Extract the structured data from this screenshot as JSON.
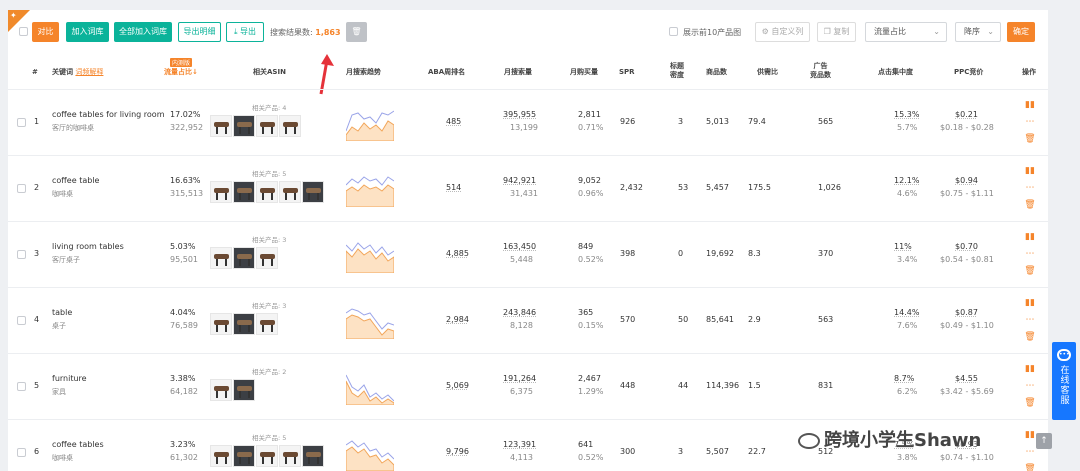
{
  "toolbar": {
    "compare": "对比",
    "add_lib": "加入词库",
    "add_all_lib": "全部加入词库",
    "export_detail": "导出明细",
    "export": "导出",
    "result_label": "搜索结果数:",
    "result_count": "1,863",
    "top10_label": "展示前10产品图",
    "custom_cols": "自定义列",
    "copy": "复制",
    "sort_field": "流量占比",
    "sort_order": "降序",
    "confirm": "确定"
  },
  "header": {
    "num": "#",
    "keyword": "关键词",
    "keyword_tag": "词频解释",
    "traffic": "流量占比↓",
    "traffic_tag": "内测版",
    "asin": "相关ASIN",
    "trend": "月搜索趋势",
    "aba": "ABA周排名",
    "search_vol": "月搜索量",
    "buy_vol": "月购买量",
    "spr": "SPR",
    "title_density_1": "标题",
    "title_density_2": "密度",
    "products": "商品数",
    "supply_ratio": "供需比",
    "ad_1": "广告",
    "ad_2": "竞品数",
    "click_conc": "点击集中度",
    "ppc": "PPC竞价",
    "ops": "操作"
  },
  "rows": [
    {
      "num": "1",
      "kw": "coffee tables for living room",
      "kw_cn": "客厅的咖啡桌",
      "traffic": "17.02%",
      "traffic_sub": "322,952",
      "related": "相关产品: 4",
      "aba": "485",
      "search": "395,955",
      "search_sub": "13,199",
      "buy": "2,811",
      "buy_sub": "0.71%",
      "spr": "926",
      "density": "3",
      "products": "5,013",
      "supply": "79.4",
      "ad": "565",
      "click": "15.3%",
      "click_sub": "5.7%",
      "ppc": "$0.21",
      "ppc_range": "$0.18 - $0.28"
    },
    {
      "num": "2",
      "kw": "coffee table",
      "kw_cn": "咖啡桌",
      "traffic": "16.63%",
      "traffic_sub": "315,513",
      "related": "相关产品: 5",
      "aba": "514",
      "search": "942,921",
      "search_sub": "31,431",
      "buy": "9,052",
      "buy_sub": "0.96%",
      "spr": "2,432",
      "density": "53",
      "products": "5,457",
      "supply": "175.5",
      "ad": "1,026",
      "click": "12.1%",
      "click_sub": "4.6%",
      "ppc": "$0.94",
      "ppc_range": "$0.75 - $1.11"
    },
    {
      "num": "3",
      "kw": "living room tables",
      "kw_cn": "客厅桌子",
      "traffic": "5.03%",
      "traffic_sub": "95,501",
      "related": "相关产品: 3",
      "aba": "4,885",
      "search": "163,450",
      "search_sub": "5,448",
      "buy": "849",
      "buy_sub": "0.52%",
      "spr": "398",
      "density": "0",
      "products": "19,692",
      "supply": "8.3",
      "ad": "370",
      "click": "11%",
      "click_sub": "3.4%",
      "ppc": "$0.70",
      "ppc_range": "$0.54 - $0.81"
    },
    {
      "num": "4",
      "kw": "table",
      "kw_cn": "桌子",
      "traffic": "4.04%",
      "traffic_sub": "76,589",
      "related": "相关产品: 3",
      "aba": "2,984",
      "search": "243,846",
      "search_sub": "8,128",
      "buy": "365",
      "buy_sub": "0.15%",
      "spr": "570",
      "density": "50",
      "products": "85,641",
      "supply": "2.9",
      "ad": "563",
      "click": "14.4%",
      "click_sub": "7.6%",
      "ppc": "$0.87",
      "ppc_range": "$0.49 - $1.10"
    },
    {
      "num": "5",
      "kw": "furniture",
      "kw_cn": "家具",
      "traffic": "3.38%",
      "traffic_sub": "64,182",
      "related": "相关产品: 2",
      "aba": "5,069",
      "search": "191,264",
      "search_sub": "6,375",
      "buy": "2,467",
      "buy_sub": "1.29%",
      "spr": "448",
      "density": "44",
      "products": "114,396",
      "supply": "1.5",
      "ad": "831",
      "click": "8.7%",
      "click_sub": "6.2%",
      "ppc": "$4.55",
      "ppc_range": "$3.42 - $5.69"
    },
    {
      "num": "6",
      "kw": "coffee tables",
      "kw_cn": "咖啡桌",
      "traffic": "3.23%",
      "traffic_sub": "61,302",
      "related": "相关产品: 5",
      "aba": "9,796",
      "search": "123,391",
      "search_sub": "4,113",
      "buy": "641",
      "buy_sub": "0.52%",
      "spr": "300",
      "density": "3",
      "products": "5,507",
      "supply": "22.7",
      "ad": "512",
      "click": "7.5%",
      "click_sub": "3.8%",
      "ppc": "$0.93",
      "ppc_range": "$0.74 - $1.10"
    }
  ],
  "side": {
    "chat": "在线客服"
  },
  "watermark": "跨境小学生Shawn",
  "colors": {
    "accent": "#f5842a",
    "green": "#0bb39a",
    "blue": "#1677ff"
  }
}
